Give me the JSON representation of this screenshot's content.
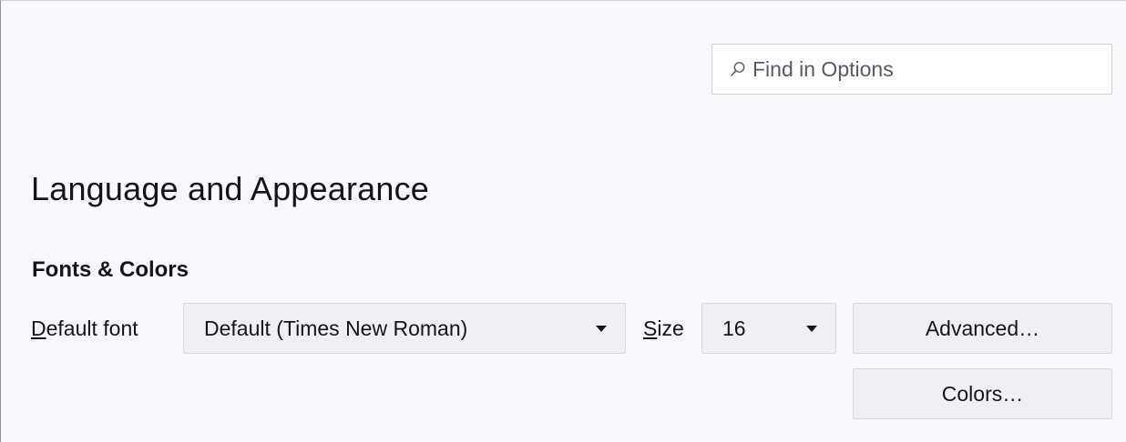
{
  "search": {
    "placeholder": "Find in Options"
  },
  "page": {
    "title": "Language and Appearance"
  },
  "fonts_colors": {
    "section_title": "Fonts & Colors",
    "default_font_label_accesskey": "D",
    "default_font_label_rest": "efault font",
    "default_font_value": "Default (Times New Roman)",
    "size_label_accesskey": "S",
    "size_label_rest": "ize",
    "size_value": "16",
    "advanced_label": "Advanced…",
    "colors_label": "Colors…"
  },
  "icons": {
    "search": "search-icon",
    "dropdown": "chevron-down-icon"
  }
}
